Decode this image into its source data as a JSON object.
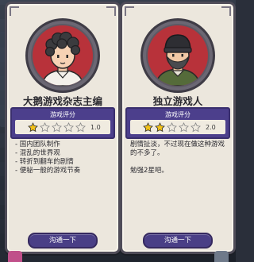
{
  "cards": [
    {
      "name": "大鹅游戏杂志主编",
      "score_label": "游戏评分",
      "stars_filled": 1,
      "stars_total": 5,
      "score": "1.0",
      "comment_lines": [
        "国内团队制作",
        "混乱的世界观",
        "转折到翻车的剧情",
        "便秘一般的游戏节奏"
      ],
      "button": "沟通一下",
      "avatar_icon": "curly-hair-reviewer-avatar"
    },
    {
      "name": "独立游戏人",
      "score_label": "游戏评分",
      "stars_filled": 2,
      "stars_total": 5,
      "score": "2.0",
      "paragraph_1": "剧情扯淡，不过现在做这种游戏的不多了。",
      "paragraph_2": "勉强2星吧。",
      "button": "沟通一下",
      "avatar_icon": "beanie-bearded-reviewer-avatar"
    }
  ],
  "colors": {
    "card_bg": "#ece7dd",
    "score_panel": "#4c3f8c",
    "button": "#4a3f86",
    "star_filled": "#f2c21a",
    "star_empty": "#9a9a9a",
    "avatar_bg": "#b8323a"
  }
}
